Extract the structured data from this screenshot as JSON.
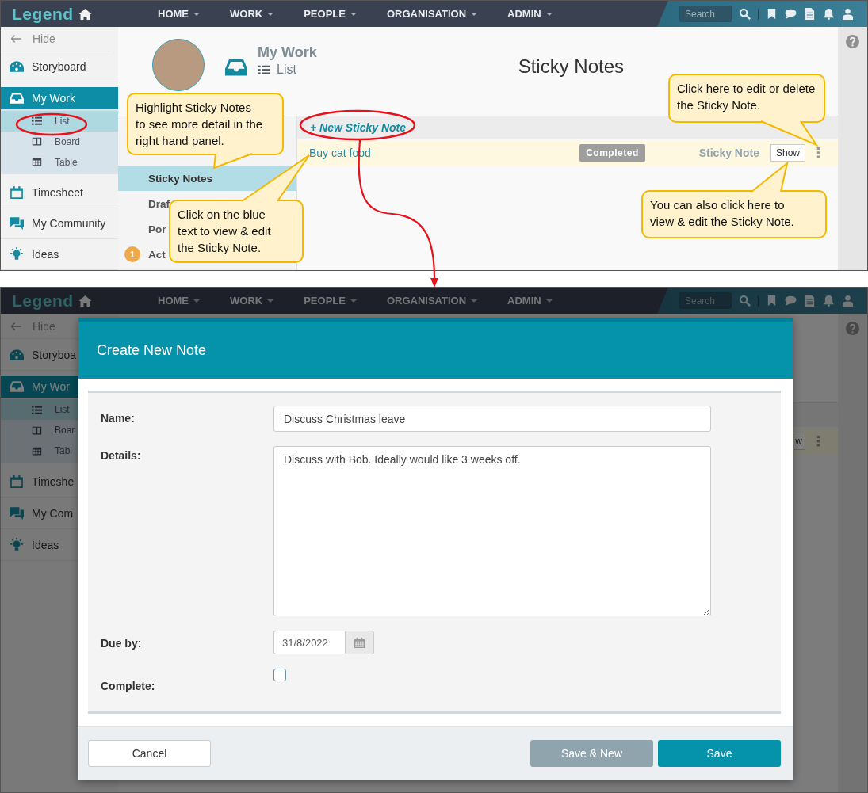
{
  "top_screen": {
    "nav": {
      "logo": "Legend",
      "menu": [
        {
          "label": "HOME"
        },
        {
          "label": "WORK"
        },
        {
          "label": "PEOPLE"
        },
        {
          "label": "ORGANISATION"
        },
        {
          "label": "ADMIN"
        }
      ],
      "search": {
        "placeholder": "Search"
      }
    },
    "sidebar": {
      "hide": "Hide",
      "items": [
        {
          "label": "Storyboard",
          "selected": false
        },
        {
          "label": "My Work",
          "selected": true,
          "children": [
            {
              "label": "List",
              "selected": true
            },
            {
              "label": "Board",
              "selected": false
            },
            {
              "label": "Table",
              "selected": false
            }
          ]
        },
        {
          "label": "Timesheet",
          "selected": false
        },
        {
          "label": "My Community",
          "selected": false
        },
        {
          "label": "Ideas",
          "selected": false
        }
      ]
    },
    "header": {
      "section": "My Work",
      "view": "List",
      "title": "Sticky Notes"
    },
    "subnav": [
      {
        "label": "Sticky Notes",
        "selected": true
      },
      {
        "label": "Draf",
        "selected": false
      },
      {
        "label": "Por",
        "selected": false
      },
      {
        "label": "Act",
        "selected": false,
        "badge": "1"
      }
    ],
    "notes": {
      "new_link": "+ New Sticky Note",
      "rows": [
        {
          "title": "Buy cat food",
          "status": "Completed",
          "type": "Sticky Note",
          "action": "Show"
        }
      ]
    }
  },
  "callouts": [
    {
      "text": "Highlight Sticky Notes to see more detail in the right hand panel."
    },
    {
      "text": "Click on the blue text to view & edit the Sticky Note."
    },
    {
      "text": "Click here to edit or delete the Sticky Note."
    },
    {
      "text": "You can also click here to view & edit the Sticky Note."
    }
  ],
  "bottom_screen": {
    "nav": {
      "logo": "Legend",
      "menu": [
        {
          "label": "HOME"
        },
        {
          "label": "WORK"
        },
        {
          "label": "PEOPLE"
        },
        {
          "label": "ORGANISATION"
        },
        {
          "label": "ADMIN"
        }
      ],
      "search": {
        "placeholder": "Search"
      }
    },
    "sidebar": {
      "hide": "Hide",
      "items": [
        {
          "label": "Storyboa",
          "selected": false
        },
        {
          "label": "My Wor",
          "selected": true,
          "children": [
            {
              "label": "List",
              "selected": true
            },
            {
              "label": "Boar",
              "selected": false
            },
            {
              "label": "Tabl",
              "selected": false
            }
          ]
        },
        {
          "label": "Timeshe",
          "selected": false
        },
        {
          "label": "My Com",
          "selected": false
        },
        {
          "label": "Ideas",
          "selected": false
        }
      ]
    },
    "row_action": "w",
    "modal": {
      "title": "Create New Note",
      "fields": [
        {
          "kind": "text",
          "label": "Name:",
          "value": "Discuss Christmas leave"
        },
        {
          "kind": "textarea",
          "label": "Details:",
          "value": "Discuss with Bob. Ideally would like 3 weeks off."
        },
        {
          "kind": "date",
          "label": "Due by:",
          "value": "31/8/2022"
        },
        {
          "kind": "checkbox",
          "label": "Complete:",
          "checked": false
        }
      ],
      "buttons": [
        {
          "kind": "secondary",
          "label": "Cancel"
        },
        {
          "kind": "muted",
          "label": "Save & New"
        },
        {
          "kind": "primary",
          "label": "Save"
        }
      ]
    }
  }
}
